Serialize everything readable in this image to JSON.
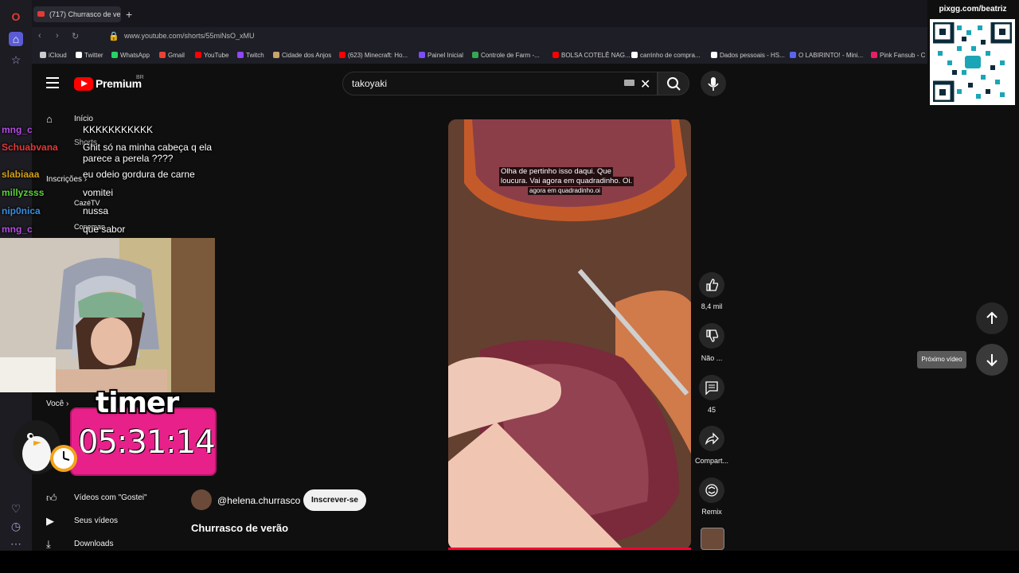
{
  "browser": {
    "tab_title": "(717) Churrasco de ve",
    "url": "www.youtube.com/shorts/55miNsO_xMU",
    "bookmarks": [
      "iCloud",
      "Twitter",
      "WhatsApp",
      "Gmail",
      "YouTube",
      "Twitch",
      "Cidade dos Anjos",
      "(623) Minecraft: Ho...",
      "Painel Inicial",
      "Controle de Farm -...",
      "BOLSA COTELÊ NAG...",
      "carrinho de compra...",
      "Dados pessoais - HS...",
      "O LABIRINTO! - Mini...",
      "Pink Fansub - C"
    ]
  },
  "youtube": {
    "brand": "Premium",
    "region": "BR",
    "search_value": "takoyaki",
    "sidebar": {
      "inicio": "Início",
      "shorts": "Shorts",
      "inscricoes": "Inscrições",
      "channel1": "CazéTV",
      "channel2": "Coneman",
      "voce": "Você",
      "liked": "Vídeos com \"Gostei\"",
      "your_videos": "Seus vídeos",
      "downloads": "Downloads"
    },
    "short": {
      "subtitle_line1": "Olha de pertinho isso daqui. Que",
      "subtitle_line2": "loucura. Vai agora em quadradinho. Oi.",
      "subtitle_line3": "agora em quadradinho.oi",
      "likes": "8,4 mil",
      "dislike_label": "Não ...",
      "comments": "45",
      "share_label": "Compart...",
      "remix_label": "Remix",
      "channel": "@helena.churrasco",
      "subscribe": "Inscrever-se",
      "title": "Churrasco de verão",
      "next_tooltip": "Próximo vídeo"
    }
  },
  "stream_overlay": {
    "chat": [
      {
        "user": "mng_c",
        "color": "#b44de0",
        "msg": "KKKKKKKKKKK"
      },
      {
        "user": "Schuabvana",
        "color": "#e03a3a",
        "msg": "Ghit só na minha cabeça q ela"
      },
      {
        "user": "",
        "color": "#ffffff",
        "msg": "parece a perela ????"
      },
      {
        "user": "slabiaaa",
        "color": "#d4a017",
        "msg": "eu odeio gordura de carne"
      },
      {
        "user": "millyzsss",
        "color": "#5ad13a",
        "msg": "vomitei"
      },
      {
        "user": "nip0nica",
        "color": "#3a8ee0",
        "msg": "nussa"
      },
      {
        "user": "mng_c",
        "color": "#b44de0",
        "msg": "que sabor"
      }
    ],
    "timer_title": "timer",
    "timer_value": "05:31:14",
    "qr_label": "pixgg.com/beatriz"
  }
}
